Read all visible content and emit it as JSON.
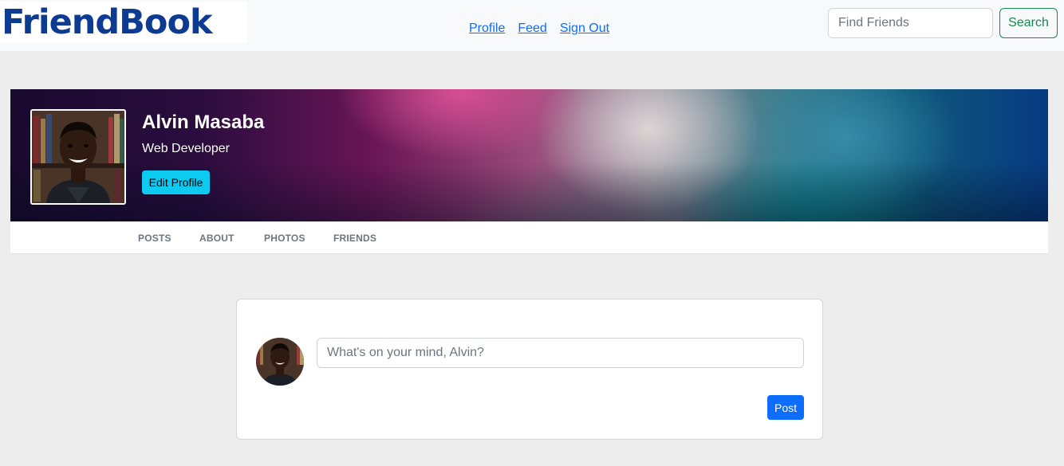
{
  "navbar": {
    "brand": "FriendBook",
    "links": [
      {
        "label": "Profile"
      },
      {
        "label": "Feed"
      },
      {
        "label": "Sign Out"
      }
    ],
    "search": {
      "placeholder": "Find Friends",
      "value": "",
      "button_label": "Search"
    }
  },
  "profile": {
    "name": "Alvin Masaba",
    "title": "Web Developer",
    "edit_button_label": "Edit Profile",
    "tabs": [
      {
        "label": "POSTS"
      },
      {
        "label": "ABOUT"
      },
      {
        "label": "PHOTOS"
      },
      {
        "label": "FRIENDS"
      }
    ]
  },
  "composer": {
    "placeholder": "What's on your mind, Alvin?",
    "value": "",
    "post_button_label": "Post"
  },
  "colors": {
    "brand": "#0d3b91",
    "link": "#0d6efd",
    "search_button": "#198754",
    "edit_button": "#0dcaf0",
    "post_button": "#0d6efd",
    "page_background": "#ededed"
  }
}
